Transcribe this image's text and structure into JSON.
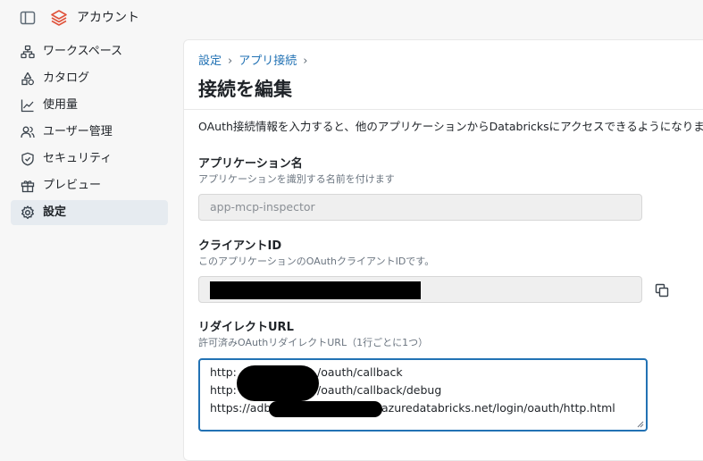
{
  "app": {
    "title": "アカウント"
  },
  "sidebar": {
    "items": [
      {
        "label": "ワークスペース",
        "icon": "workspace-icon"
      },
      {
        "label": "カタログ",
        "icon": "catalog-icon"
      },
      {
        "label": "使用量",
        "icon": "usage-chart-icon"
      },
      {
        "label": "ユーザー管理",
        "icon": "users-icon"
      },
      {
        "label": "セキュリティ",
        "icon": "shield-icon"
      },
      {
        "label": "プレビュー",
        "icon": "gift-icon"
      },
      {
        "label": "設定",
        "icon": "gear-icon",
        "active": true
      }
    ]
  },
  "breadcrumb": {
    "items": [
      "設定",
      "アプリ接続"
    ],
    "separator": "›"
  },
  "page": {
    "title": "接続を編集",
    "description": "OAuth接続情報を入力すると、他のアプリケーションからDatabricksにアクセスできるようになります。"
  },
  "form": {
    "app_name": {
      "label": "アプリケーション名",
      "hint": "アプリケーションを識別する名前を付けます",
      "value": "app-mcp-inspector"
    },
    "client_id": {
      "label": "クライアントID",
      "hint": "このアプリケーションのOAuthクライアントIDです。",
      "value_redacted": true
    },
    "redirect_url": {
      "label": "リダイレクトURL",
      "hint": "許可済みOAuthリダイレクトURL（1行ごとに1つ）",
      "lines": [
        {
          "prefix": "http:",
          "suffix": "/oauth/callback"
        },
        {
          "prefix": "http:",
          "suffix": "/oauth/callback/debug"
        },
        {
          "prefix": "https://adb",
          "suffix": "azuredatabricks.net/login/oauth/http.html"
        }
      ]
    }
  },
  "colors": {
    "accent": "#2272b4",
    "active_nav_bg": "#e6ebf0",
    "brand": "#e0533c"
  }
}
